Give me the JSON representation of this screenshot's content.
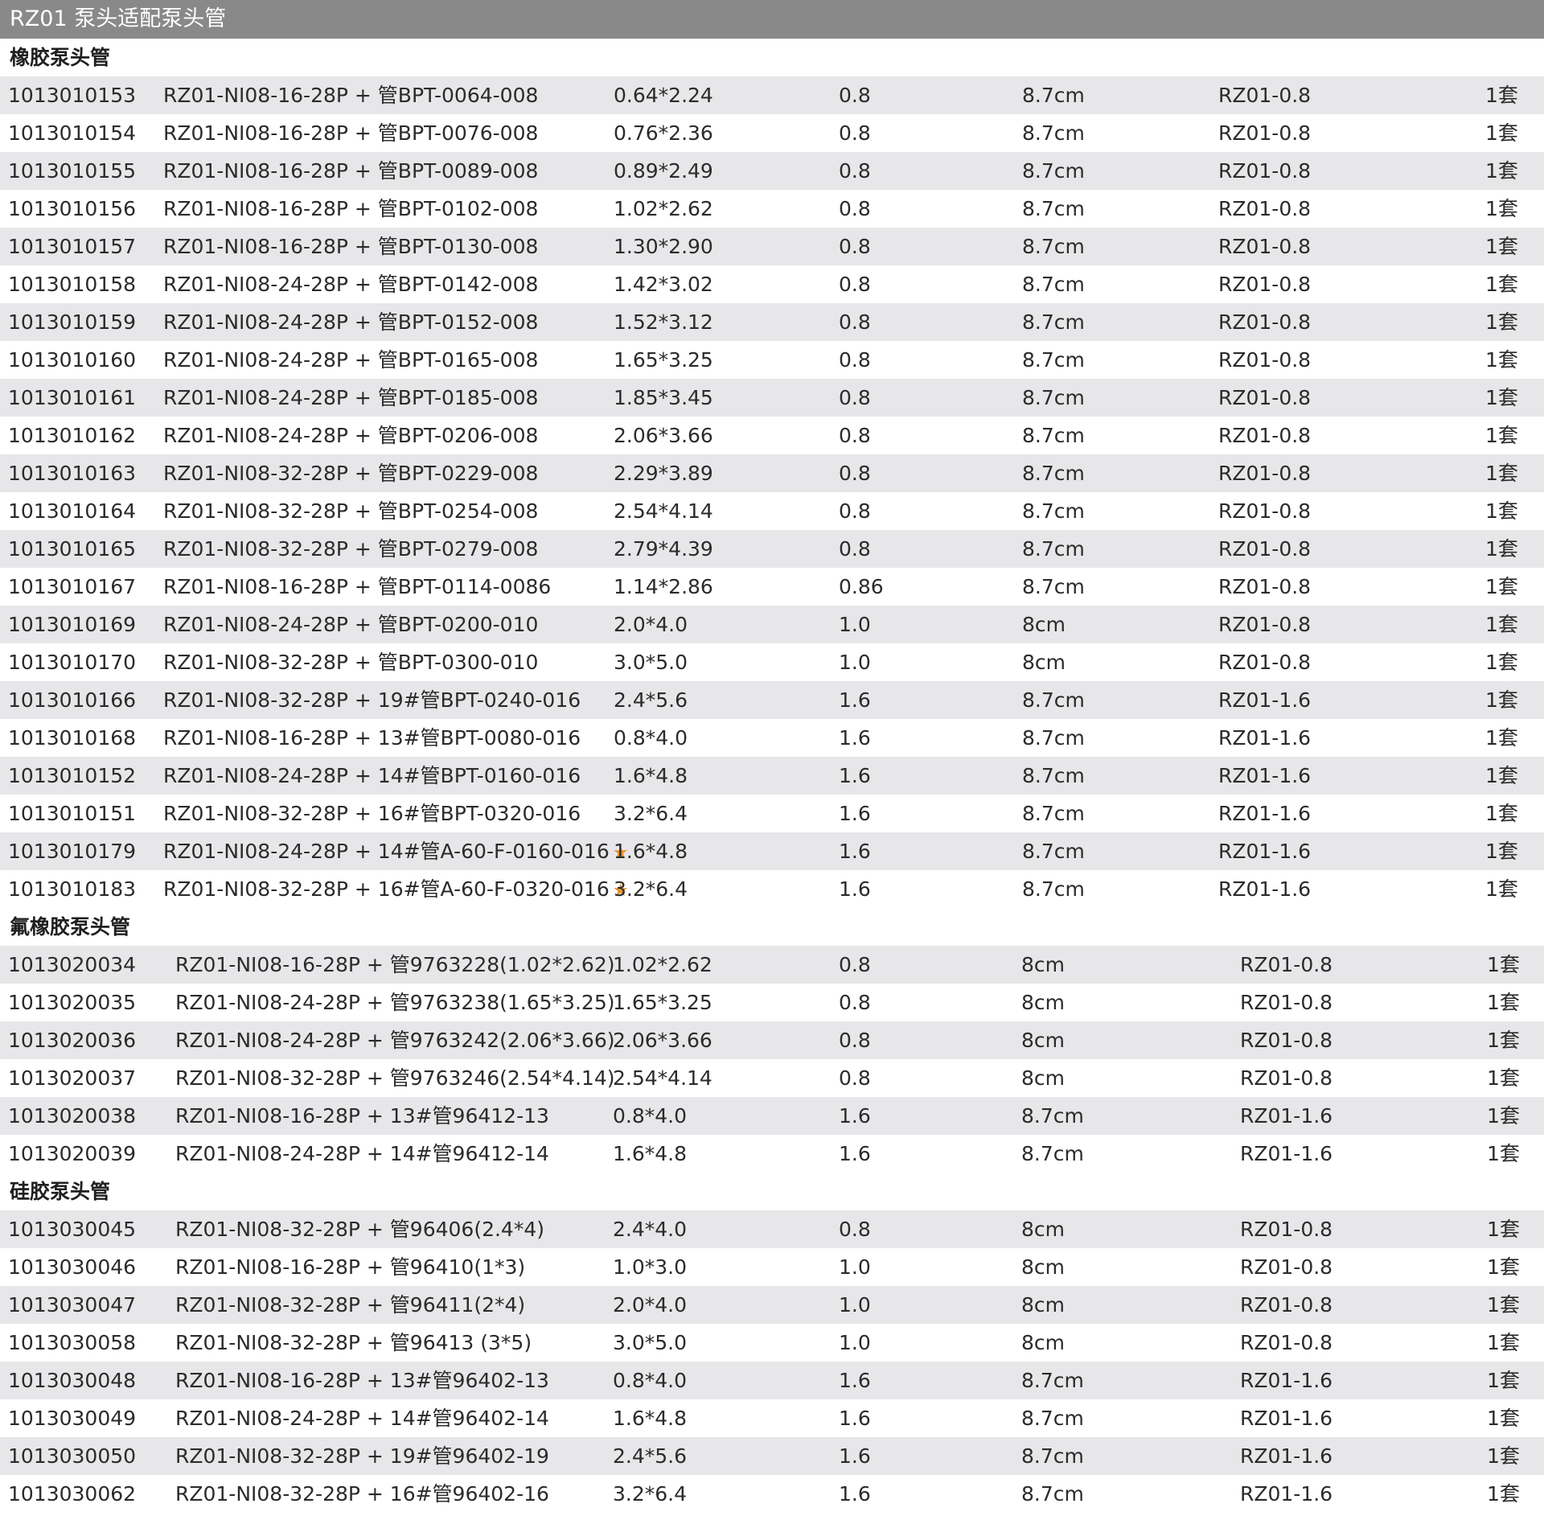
{
  "title": "RZ01 泵头适配泵头管",
  "colors": {
    "title_bg": "#898989",
    "row_shade": "#e7e7e9",
    "star": "#e8922d"
  },
  "star_icon": "star-icon",
  "sections": [
    {
      "heading": "橡胶泵头管",
      "rows": [
        {
          "code": "1013010153",
          "model": "RZ01-NI08-16-28P + 管BPT-0064-008",
          "size": "0.64*2.24",
          "wall": "0.8",
          "length": "8.7cm",
          "fit": "RZ01-0.8",
          "qty": "1套",
          "star": false
        },
        {
          "code": "1013010154",
          "model": "RZ01-NI08-16-28P + 管BPT-0076-008",
          "size": "0.76*2.36",
          "wall": "0.8",
          "length": "8.7cm",
          "fit": "RZ01-0.8",
          "qty": "1套",
          "star": false
        },
        {
          "code": "1013010155",
          "model": "RZ01-NI08-16-28P + 管BPT-0089-008",
          "size": "0.89*2.49",
          "wall": "0.8",
          "length": "8.7cm",
          "fit": "RZ01-0.8",
          "qty": "1套",
          "star": false
        },
        {
          "code": "1013010156",
          "model": "RZ01-NI08-16-28P + 管BPT-0102-008",
          "size": "1.02*2.62",
          "wall": "0.8",
          "length": "8.7cm",
          "fit": "RZ01-0.8",
          "qty": "1套",
          "star": false
        },
        {
          "code": "1013010157",
          "model": "RZ01-NI08-16-28P + 管BPT-0130-008",
          "size": "1.30*2.90",
          "wall": "0.8",
          "length": "8.7cm",
          "fit": "RZ01-0.8",
          "qty": "1套",
          "star": false
        },
        {
          "code": "1013010158",
          "model": "RZ01-NI08-24-28P + 管BPT-0142-008",
          "size": "1.42*3.02",
          "wall": "0.8",
          "length": "8.7cm",
          "fit": "RZ01-0.8",
          "qty": "1套",
          "star": false
        },
        {
          "code": "1013010159",
          "model": "RZ01-NI08-24-28P + 管BPT-0152-008",
          "size": "1.52*3.12",
          "wall": "0.8",
          "length": "8.7cm",
          "fit": "RZ01-0.8",
          "qty": "1套",
          "star": false
        },
        {
          "code": "1013010160",
          "model": "RZ01-NI08-24-28P + 管BPT-0165-008",
          "size": "1.65*3.25",
          "wall": "0.8",
          "length": "8.7cm",
          "fit": "RZ01-0.8",
          "qty": "1套",
          "star": false
        },
        {
          "code": "1013010161",
          "model": "RZ01-NI08-24-28P + 管BPT-0185-008",
          "size": "1.85*3.45",
          "wall": "0.8",
          "length": "8.7cm",
          "fit": "RZ01-0.8",
          "qty": "1套",
          "star": false
        },
        {
          "code": "1013010162",
          "model": "RZ01-NI08-24-28P + 管BPT-0206-008",
          "size": "2.06*3.66",
          "wall": "0.8",
          "length": "8.7cm",
          "fit": "RZ01-0.8",
          "qty": "1套",
          "star": false
        },
        {
          "code": "1013010163",
          "model": "RZ01-NI08-32-28P + 管BPT-0229-008",
          "size": "2.29*3.89",
          "wall": "0.8",
          "length": "8.7cm",
          "fit": "RZ01-0.8",
          "qty": "1套",
          "star": false
        },
        {
          "code": "1013010164",
          "model": "RZ01-NI08-32-28P + 管BPT-0254-008",
          "size": "2.54*4.14",
          "wall": "0.8",
          "length": "8.7cm",
          "fit": "RZ01-0.8",
          "qty": "1套",
          "star": false
        },
        {
          "code": "1013010165",
          "model": "RZ01-NI08-32-28P + 管BPT-0279-008",
          "size": "2.79*4.39",
          "wall": "0.8",
          "length": "8.7cm",
          "fit": "RZ01-0.8",
          "qty": "1套",
          "star": false
        },
        {
          "code": "1013010167",
          "model": "RZ01-NI08-16-28P + 管BPT-0114-0086",
          "size": "1.14*2.86",
          "wall": "0.86",
          "length": "8.7cm",
          "fit": "RZ01-0.8",
          "qty": "1套",
          "star": false
        },
        {
          "code": "1013010169",
          "model": "RZ01-NI08-24-28P + 管BPT-0200-010",
          "size": "2.0*4.0",
          "wall": "1.0",
          "length": "8cm",
          "fit": "RZ01-0.8",
          "qty": "1套",
          "star": false
        },
        {
          "code": "1013010170",
          "model": "RZ01-NI08-32-28P + 管BPT-0300-010",
          "size": "3.0*5.0",
          "wall": "1.0",
          "length": "8cm",
          "fit": "RZ01-0.8",
          "qty": "1套",
          "star": false
        },
        {
          "code": "1013010166",
          "model": "RZ01-NI08-32-28P + 19#管BPT-0240-016",
          "size": "2.4*5.6",
          "wall": "1.6",
          "length": "8.7cm",
          "fit": "RZ01-1.6",
          "qty": "1套",
          "star": false
        },
        {
          "code": "1013010168",
          "model": "RZ01-NI08-16-28P + 13#管BPT-0080-016",
          "size": "0.8*4.0",
          "wall": "1.6",
          "length": "8.7cm",
          "fit": "RZ01-1.6",
          "qty": "1套",
          "star": false
        },
        {
          "code": "1013010152",
          "model": "RZ01-NI08-24-28P + 14#管BPT-0160-016",
          "size": "1.6*4.8",
          "wall": "1.6",
          "length": "8.7cm",
          "fit": "RZ01-1.6",
          "qty": "1套",
          "star": false
        },
        {
          "code": "1013010151",
          "model": "RZ01-NI08-32-28P + 16#管BPT-0320-016",
          "size": "3.2*6.4",
          "wall": "1.6",
          "length": "8.7cm",
          "fit": "RZ01-1.6",
          "qty": "1套",
          "star": false
        },
        {
          "code": "1013010179",
          "model": "RZ01-NI08-24-28P + 14#管A-60-F-0160-016",
          "size": "1.6*4.8",
          "wall": "1.6",
          "length": "8.7cm",
          "fit": "RZ01-1.6",
          "qty": "1套",
          "star": true
        },
        {
          "code": "1013010183",
          "model": "RZ01-NI08-32-28P + 16#管A-60-F-0320-016",
          "size": "3.2*6.4",
          "wall": "1.6",
          "length": "8.7cm",
          "fit": "RZ01-1.6",
          "qty": "1套",
          "star": true
        }
      ]
    },
    {
      "heading": "氟橡胶泵头管",
      "rows": [
        {
          "code": "1013020034",
          "model": "RZ01-NI08-16-28P + 管9763228(1.02*2.62)",
          "size": "1.02*2.62",
          "wall": "0.8",
          "length": "8cm",
          "fit": "RZ01-0.8",
          "qty": "1套",
          "star": false
        },
        {
          "code": "1013020035",
          "model": "RZ01-NI08-24-28P + 管9763238(1.65*3.25)",
          "size": "1.65*3.25",
          "wall": "0.8",
          "length": "8cm",
          "fit": "RZ01-0.8",
          "qty": "1套",
          "star": false
        },
        {
          "code": "1013020036",
          "model": "RZ01-NI08-24-28P + 管9763242(2.06*3.66)",
          "size": "2.06*3.66",
          "wall": "0.8",
          "length": "8cm",
          "fit": "RZ01-0.8",
          "qty": "1套",
          "star": false
        },
        {
          "code": "1013020037",
          "model": "RZ01-NI08-32-28P + 管9763246(2.54*4.14)",
          "size": "2.54*4.14",
          "wall": "0.8",
          "length": "8cm",
          "fit": "RZ01-0.8",
          "qty": "1套",
          "star": false
        },
        {
          "code": "1013020038",
          "model": "RZ01-NI08-16-28P + 13#管96412-13",
          "size": "0.8*4.0",
          "wall": "1.6",
          "length": "8.7cm",
          "fit": "RZ01-1.6",
          "qty": "1套",
          "star": false
        },
        {
          "code": "1013020039",
          "model": "RZ01-NI08-24-28P + 14#管96412-14",
          "size": "1.6*4.8",
          "wall": "1.6",
          "length": "8.7cm",
          "fit": "RZ01-1.6",
          "qty": "1套",
          "star": false
        }
      ]
    },
    {
      "heading": "硅胶泵头管",
      "rows": [
        {
          "code": "1013030045",
          "model": "RZ01-NI08-32-28P + 管96406(2.4*4)",
          "size": "2.4*4.0",
          "wall": "0.8",
          "length": "8cm",
          "fit": "RZ01-0.8",
          "qty": "1套",
          "star": false
        },
        {
          "code": "1013030046",
          "model": "RZ01-NI08-16-28P + 管96410(1*3)",
          "size": "1.0*3.0",
          "wall": "1.0",
          "length": "8cm",
          "fit": "RZ01-0.8",
          "qty": "1套",
          "star": false
        },
        {
          "code": "1013030047",
          "model": "RZ01-NI08-32-28P + 管96411(2*4)",
          "size": "2.0*4.0",
          "wall": "1.0",
          "length": "8cm",
          "fit": "RZ01-0.8",
          "qty": "1套",
          "star": false
        },
        {
          "code": "1013030058",
          "model": "RZ01-NI08-32-28P + 管96413 (3*5)",
          "size": "3.0*5.0",
          "wall": "1.0",
          "length": "8cm",
          "fit": "RZ01-0.8",
          "qty": "1套",
          "star": false
        },
        {
          "code": "1013030048",
          "model": "RZ01-NI08-16-28P + 13#管96402-13",
          "size": "0.8*4.0",
          "wall": "1.6",
          "length": "8.7cm",
          "fit": "RZ01-1.6",
          "qty": "1套",
          "star": false
        },
        {
          "code": "1013030049",
          "model": "RZ01-NI08-24-28P + 14#管96402-14",
          "size": "1.6*4.8",
          "wall": "1.6",
          "length": "8.7cm",
          "fit": "RZ01-1.6",
          "qty": "1套",
          "star": false
        },
        {
          "code": "1013030050",
          "model": "RZ01-NI08-32-28P + 19#管96402-19",
          "size": "2.4*5.6",
          "wall": "1.6",
          "length": "8.7cm",
          "fit": "RZ01-1.6",
          "qty": "1套",
          "star": false
        },
        {
          "code": "1013030062",
          "model": "RZ01-NI08-32-28P + 16#管96402-16",
          "size": "3.2*6.4",
          "wall": "1.6",
          "length": "8.7cm",
          "fit": "RZ01-1.6",
          "qty": "1套",
          "star": false
        }
      ]
    }
  ]
}
